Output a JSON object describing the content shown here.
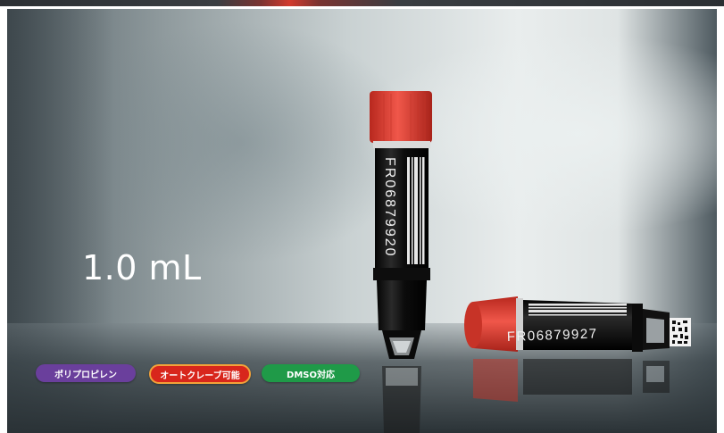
{
  "product": {
    "volume_label": "1.0 mL",
    "tube_upright_code": "FR06879920",
    "tube_lying_code": "FR06879927"
  },
  "badges": [
    {
      "label": "ポリプロピレン",
      "color": "#6a3f9c"
    },
    {
      "label": "オートクレーブ可能",
      "color": "#d8261c"
    },
    {
      "label": "DMSO対応",
      "color": "#1f9a48"
    }
  ],
  "colors": {
    "cap": "#e8493b",
    "tube_body": "#1a1a1a",
    "background_light": "#e9eded",
    "background_dark": "#4e5a60"
  }
}
